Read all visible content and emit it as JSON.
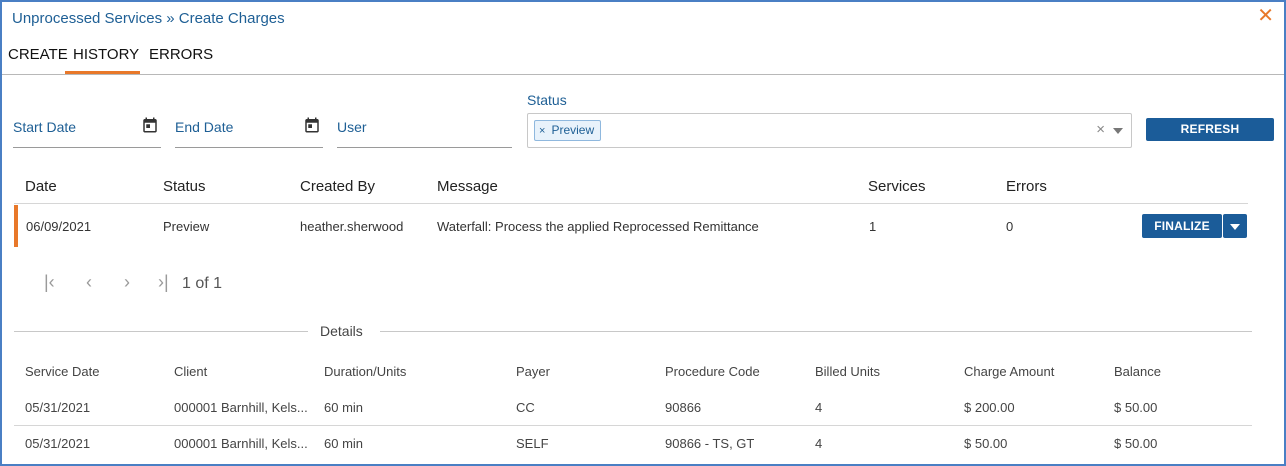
{
  "window": {
    "title": "Unprocessed Services » Create Charges",
    "close_glyph": "✕"
  },
  "tabs": [
    {
      "label": "CREATE",
      "active": false
    },
    {
      "label": "HISTORY",
      "active": true
    },
    {
      "label": "ERRORS",
      "active": false
    }
  ],
  "filters": {
    "start_date": "Start Date",
    "end_date": "End Date",
    "user": "User",
    "status_label": "Status",
    "status_chip": "Preview",
    "chip_remove": "×",
    "clear": "×"
  },
  "refresh_label": "REFRESH",
  "history": {
    "headers": [
      "Date",
      "Status",
      "Created By",
      "Message",
      "Services",
      "Errors"
    ],
    "rows": [
      {
        "date": "06/09/2021",
        "status": "Preview",
        "created_by": "heather.sherwood",
        "message": "Waterfall: Process the applied Reprocessed Remittance",
        "services": "1",
        "errors": "0",
        "action": "FINALIZE"
      }
    ]
  },
  "pager": {
    "first": "|‹",
    "prev": "‹",
    "next": "›",
    "last": "›|",
    "text": "1 of 1"
  },
  "details": {
    "label": "Details",
    "headers": [
      "Service Date",
      "Client",
      "Duration/Units",
      "Payer",
      "Procedure Code",
      "Billed Units",
      "Charge Amount",
      "Balance"
    ],
    "rows": [
      [
        "05/31/2021",
        "000001 Barnhill, Kels...",
        "60 min",
        "CC",
        "90866",
        "4",
        "$ 200.00",
        "$ 50.00"
      ],
      [
        "05/31/2021",
        "000001 Barnhill, Kels...",
        "60 min",
        "SELF",
        "90866 - TS, GT",
        "4",
        "$ 50.00",
        "$ 50.00"
      ]
    ]
  },
  "colors": {
    "accent": "#e8782a",
    "primary": "#1b5c99",
    "link": "#1e5f95",
    "frame": "#4a7fc4"
  },
  "icons": {
    "calendar": "calendar-icon",
    "close": "close-icon",
    "chevron": "chevron-down-icon"
  }
}
